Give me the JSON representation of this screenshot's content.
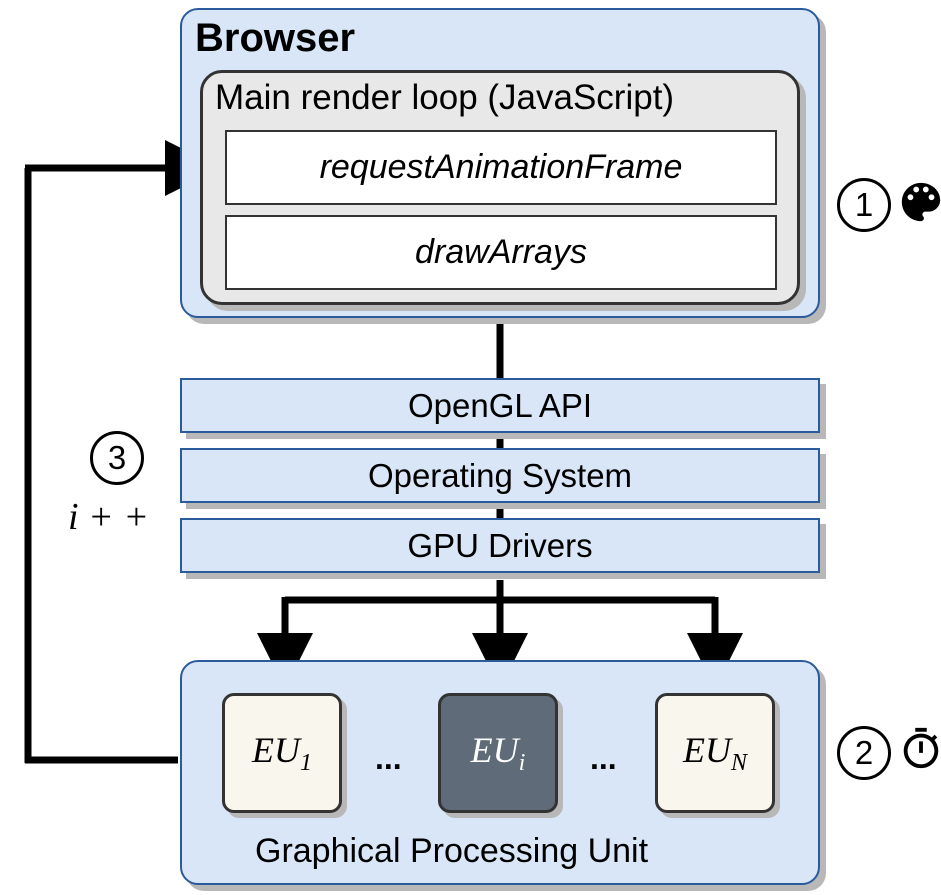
{
  "browser": {
    "title": "Browser",
    "render_loop_title": "Main render loop (JavaScript)",
    "raf": "requestAnimationFrame",
    "draw": "drawArrays"
  },
  "layers": {
    "opengl": "OpenGL API",
    "os": "Operating System",
    "drivers": "GPU Drivers"
  },
  "gpu": {
    "title": "Graphical Processing Unit",
    "eu1_prefix": "EU",
    "eu1_sub": "1",
    "eui_prefix": "EU",
    "eui_sub": "i",
    "eun_prefix": "EU",
    "eun_sub": "N",
    "ellipsis": "..."
  },
  "steps": {
    "s1": "1",
    "s2": "2",
    "s3": "3",
    "s3_label": "i + +"
  }
}
